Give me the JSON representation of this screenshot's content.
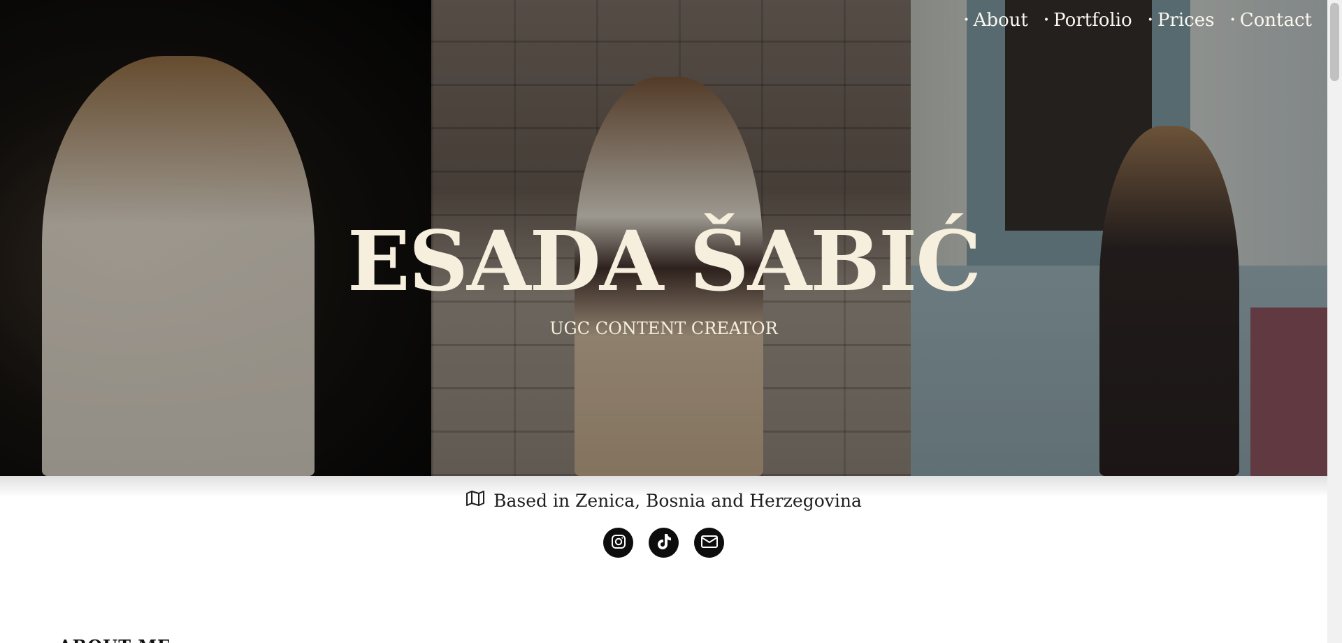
{
  "nav": {
    "items": [
      {
        "label": "About"
      },
      {
        "label": "Portfolio"
      },
      {
        "label": "Prices"
      },
      {
        "label": "Contact"
      }
    ],
    "bullet": "•"
  },
  "hero": {
    "title": "ESADA ŠABIĆ",
    "subtitle": "UGC CONTENT CREATOR"
  },
  "location": {
    "icon": "map-icon",
    "text": "Based in Zenica, Bosnia and Herzegovina"
  },
  "socials": [
    {
      "icon": "instagram-icon"
    },
    {
      "icon": "tiktok-icon"
    },
    {
      "icon": "mail-icon"
    }
  ],
  "section": {
    "heading": "ABOUT ME"
  },
  "colors": {
    "title": "#f6efdd",
    "social_bg": "#0d0d0d",
    "text": "#1f1f1f"
  }
}
